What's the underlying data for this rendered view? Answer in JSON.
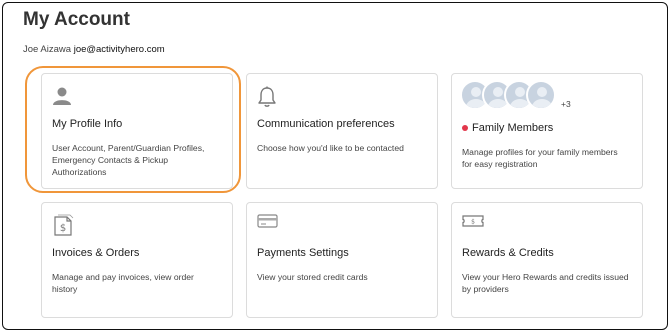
{
  "page": {
    "title": "My Account",
    "user_name": "Joe Aizawa",
    "user_email": "joe@activityhero.com"
  },
  "cards": {
    "profile": {
      "title": "My Profile Info",
      "description": "User Account, Parent/Guardian Profiles, Emergency Contacts & Pickup Authorizations",
      "icon": "person-icon"
    },
    "communication": {
      "title": "Communication preferences",
      "description": "Choose how you'd like to be contacted",
      "icon": "bell-icon"
    },
    "family": {
      "title": "Family Members",
      "description": "Manage profiles for your family members for easy registration",
      "extra_count": "+3",
      "icon": "avatar-group-icon"
    },
    "invoices": {
      "title": "Invoices & Orders",
      "description": "Manage and pay invoices, view order history",
      "icon": "invoice-icon"
    },
    "payments": {
      "title": "Payments Settings",
      "description": "View your stored credit cards",
      "icon": "credit-card-icon"
    },
    "rewards": {
      "title": "Rewards & Credits",
      "description": "View your Hero Rewards and credits issued by providers",
      "icon": "ticket-icon"
    }
  },
  "colors": {
    "highlight": "#f0963a",
    "notification_dot": "#e2374b"
  }
}
